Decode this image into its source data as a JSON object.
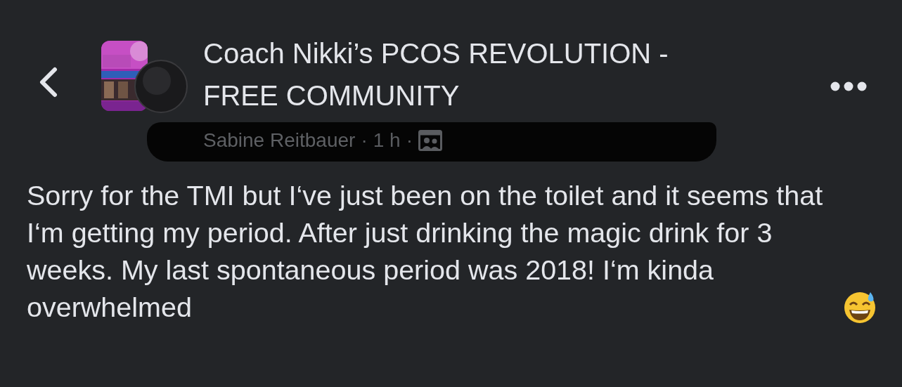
{
  "group": {
    "name": "Coach Nikki’s PCOS REVOLUTION - FREE COMMUNITY"
  },
  "meta": {
    "author": "Sabine Reitbauer",
    "separator": "·",
    "time": "1 h",
    "author_redacted": true
  },
  "post": {
    "text": "Sorry for the TMI but I‘ve just been on the toilet and it seems that I‘m getting my period. After just drinking the magic drink for 3 weeks. My last spontaneous period was 2018! I‘m kinda overwhelmed"
  }
}
